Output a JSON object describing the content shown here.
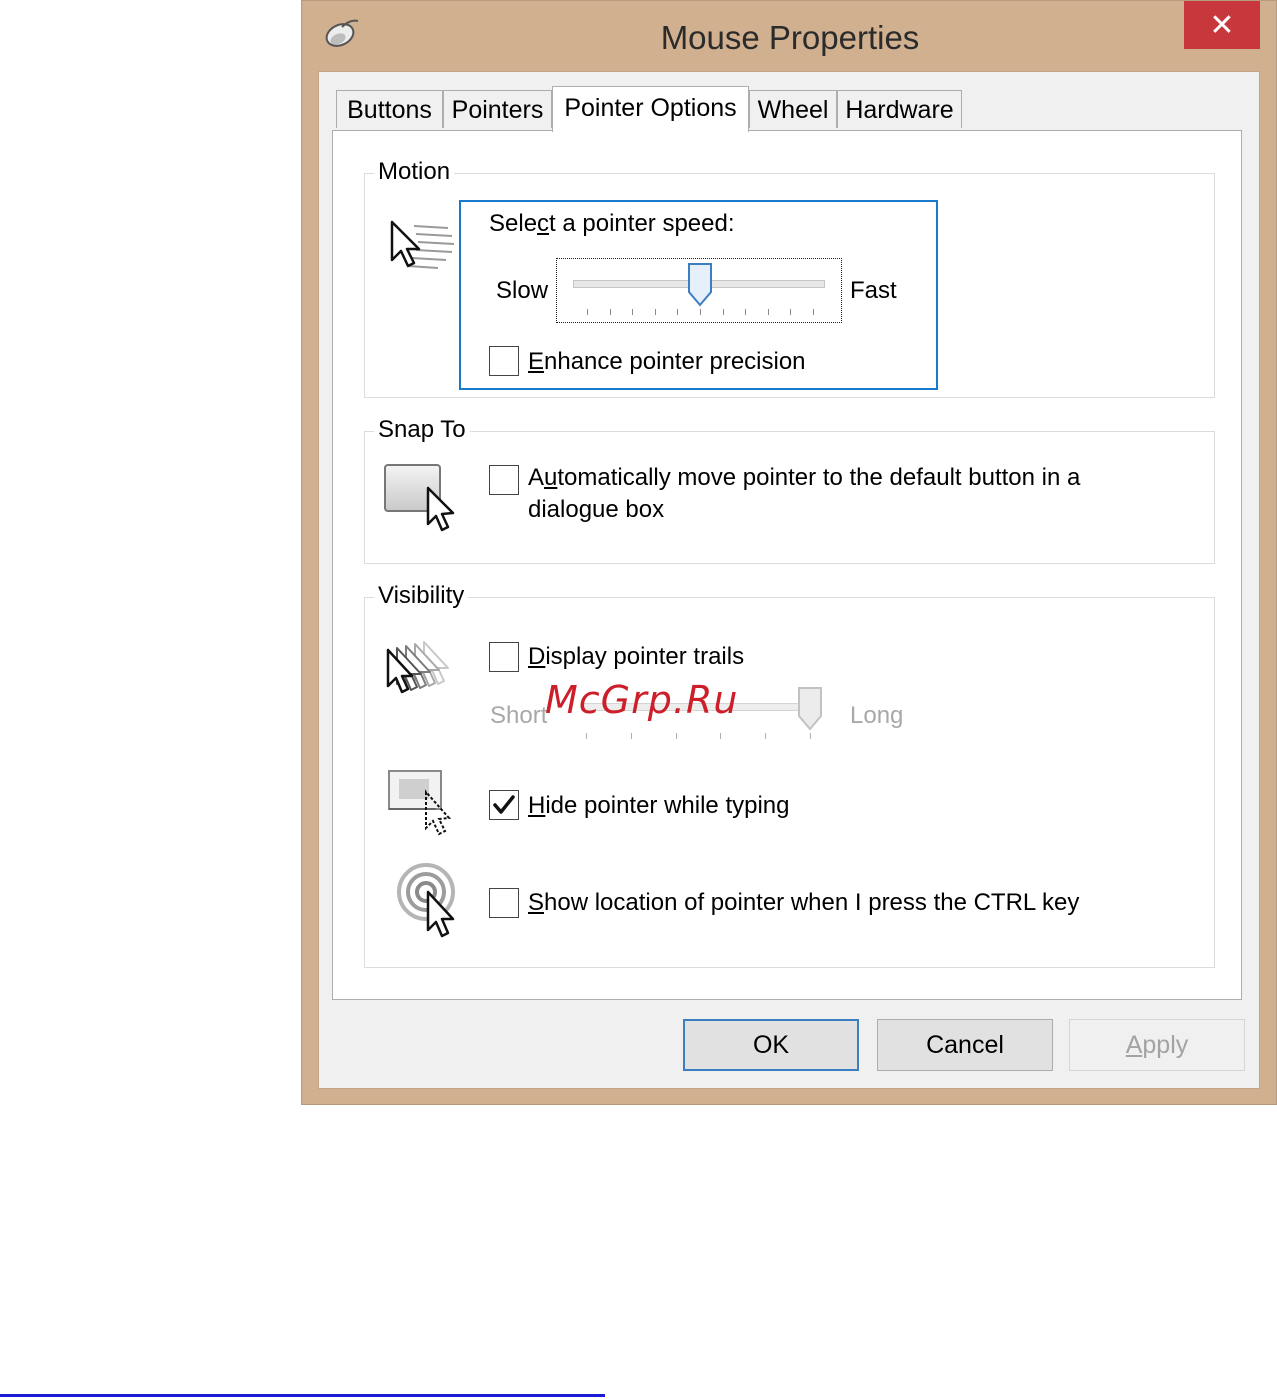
{
  "window": {
    "title": "Mouse Properties",
    "close_glyph": "✕",
    "app_icon": "mouse-icon"
  },
  "tabs": [
    {
      "label": "Buttons",
      "active": false
    },
    {
      "label": "Pointers",
      "active": false
    },
    {
      "label": "Pointer Options",
      "active": true
    },
    {
      "label": "Wheel",
      "active": false
    },
    {
      "label": "Hardware",
      "active": false
    }
  ],
  "motion": {
    "group_title": "Motion",
    "speed_label_pre": "Sele",
    "speed_label_u": "c",
    "speed_label_post": "t a pointer speed:",
    "slow": "Slow",
    "fast": "Fast",
    "speed_value": 6,
    "speed_min": 1,
    "speed_max": 11,
    "precision_u": "E",
    "precision_rest": "nhance pointer precision",
    "precision_checked": false,
    "icon": "pointer-speed-icon"
  },
  "snap": {
    "group_title": "Snap To",
    "label_pre": "A",
    "label_u": "u",
    "label_line1_rest": "tomatically move pointer to the default button in a",
    "label_line2": "dialogue box",
    "checked": false,
    "icon": "snap-to-button-icon"
  },
  "visibility": {
    "group_title": "Visibility",
    "trails_u": "D",
    "trails_rest": "isplay pointer trails",
    "trails_checked": false,
    "short": "Short",
    "long": "Long",
    "trails_value": 6,
    "trails_min": 1,
    "trails_max": 6,
    "hide_u": "H",
    "hide_rest": "ide pointer while typing",
    "hide_checked": true,
    "show_u": "S",
    "show_rest": "how location of pointer when I press the CTRL key",
    "show_checked": false
  },
  "watermark": "McGrp.Ru",
  "buttons": {
    "ok": "OK",
    "cancel": "Cancel",
    "apply_u": "A",
    "apply_rest": "pply",
    "apply_enabled": false
  },
  "colors": {
    "frame": "#d1b08f",
    "close": "#c8373b",
    "focus": "#1979ca",
    "watermark": "#cc1f2a",
    "link_line": "#1a1ad6"
  }
}
